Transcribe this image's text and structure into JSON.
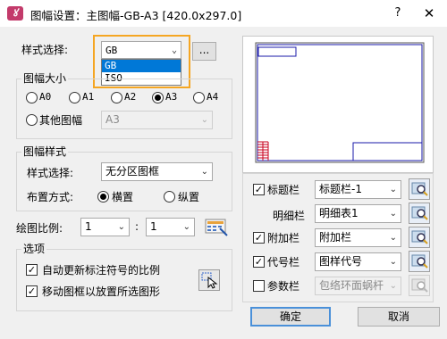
{
  "window": {
    "title": "图幅设置",
    "subtitle_sep": "：",
    "subtitle": "主图幅-GB-A3 [420.0x297.0]",
    "help": "?",
    "close": "✕"
  },
  "style_select": {
    "label": "样式选择:",
    "value": "GB",
    "more_button": "...",
    "options": [
      "GB",
      "ISO"
    ],
    "highlight_color": "#f5a623"
  },
  "size": {
    "label": "图幅大小",
    "options": [
      {
        "label": "A0",
        "selected": false
      },
      {
        "label": "A1",
        "selected": false
      },
      {
        "label": "A2",
        "selected": false
      },
      {
        "label": "A3",
        "selected": true
      },
      {
        "label": "A4",
        "selected": false
      }
    ],
    "other_label": "其他图幅",
    "other_value": "A3"
  },
  "frame_style": {
    "label": "图幅样式",
    "style_label": "样式选择:",
    "style_value": "无分区图框",
    "layout_label": "布置方式:",
    "landscape": "横置",
    "portrait": "纵置",
    "selected": "landscape"
  },
  "scale": {
    "label": "绘图比例:",
    "left": "1",
    "colon": ":",
    "right": "1"
  },
  "options": {
    "label": "选项",
    "auto_update": "自动更新标注符号的比例",
    "move_frame": "移动图框以放置所选图形"
  },
  "blocks": {
    "title_block": {
      "label": "标题栏",
      "value": "标题栏-1",
      "checked": true
    },
    "detail": {
      "label": "明细栏",
      "value": "明细表1"
    },
    "extra": {
      "label": "附加栏",
      "value": "附加栏",
      "checked": true
    },
    "code": {
      "label": "代号栏",
      "value": "图样代号",
      "checked": true
    },
    "param": {
      "label": "参数栏",
      "value": "包络环面蜗杆",
      "checked": false
    }
  },
  "buttons": {
    "ok": "确定",
    "cancel": "取消"
  },
  "preview_accent": "#c8001e",
  "preview_lines": "#1a1aa8"
}
